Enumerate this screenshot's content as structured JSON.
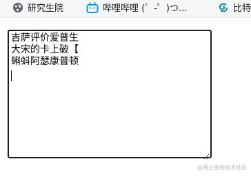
{
  "bookmarks": [
    {
      "label": "研究生院",
      "icon": "globe-icon"
    },
    {
      "label": "哔哩哔哩 (゜-゜)つ...",
      "icon": "bilibili-tv-icon"
    },
    {
      "label": "比特",
      "icon": "swirl-logo-icon"
    }
  ],
  "textarea": {
    "lines": [
      "吉萨评价爱普生",
      "大宋的卡上破【",
      "蝌蚪阿瑟康普顿",
      ""
    ]
  },
  "watermark": {
    "text": "@稀土掘金技术社区"
  },
  "colors": {
    "bilibili": "#00a1d6",
    "textarea_border": "#1c1c1c",
    "bookmark_bar": "#f5f6f7"
  }
}
